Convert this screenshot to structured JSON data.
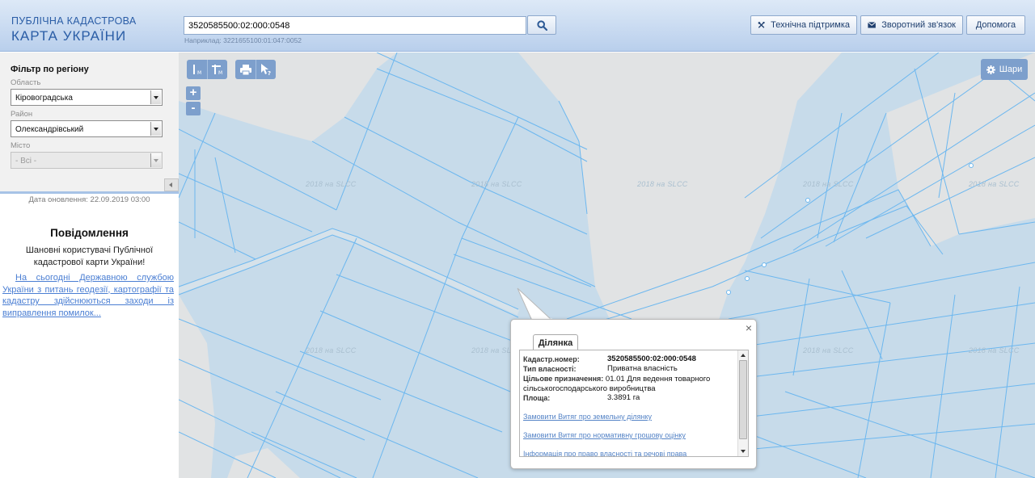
{
  "header": {
    "logo_line1": "ПУБЛІЧНА КАДАСТРОВА",
    "logo_line2": "КАРТА УКРАЇНИ",
    "search_value": "3520585500:02:000:0548",
    "search_example": "Наприклад: 3221655100:01:047:0052",
    "support_label": "Технічна підтримка",
    "feedback_label": "Зворотний зв'язок",
    "help_label": "Допомога"
  },
  "filter": {
    "title": "Фільтр по регіону",
    "oblast_label": "Область",
    "oblast_value": "Кіровоградська",
    "rayon_label": "Район",
    "rayon_value": "Олександрівський",
    "city_label": "Місто",
    "city_value": "- Всі -"
  },
  "update_date": "Дата оновлення: 22.09.2019 03:00",
  "notice": {
    "title": "Повідомлення",
    "text": "Шановні користувачі Публічної кадастрової карти України!",
    "link": "На сьогодні Державною службою України з питань геодезії, картографії та кадастру здійснюються заходи із виправлення помилок..."
  },
  "map": {
    "layers_label": "Шари",
    "zoom_in": "+",
    "zoom_out": "-",
    "watermark": "2018 на SLCC",
    "parcel_color": "#c7dbea",
    "line_color": "#6cb7ef"
  },
  "popup": {
    "close": "×",
    "tab": "Ділянка",
    "cadastral_label": "Кадастр.номер:",
    "cadastral_value": "3520585500:02:000:0548",
    "ownership_label": "Тип власності:",
    "ownership_value": "Приватна власність",
    "purpose_label": "Цільове призначення:",
    "purpose_value": "01.01 Для ведення товарного сільськогосподарського виробництва",
    "area_label": "Площа:",
    "area_value": "3.3891 га",
    "link1": "Замовити Витяг про земельну ділянку",
    "link2": "Замовити Витяг про нормативну грошову оцінку",
    "link3": "Інформація про право власності та речові права"
  }
}
